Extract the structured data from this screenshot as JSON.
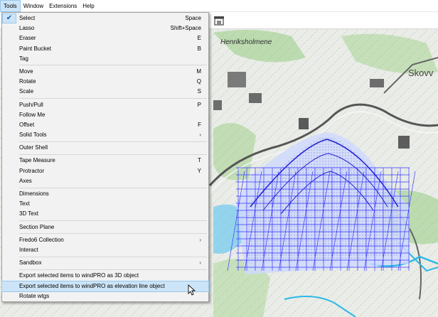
{
  "menubar": {
    "items": [
      {
        "label": "Tools",
        "active": true
      },
      {
        "label": "Window",
        "active": false
      },
      {
        "label": "Extensions",
        "active": false
      },
      {
        "label": "Help",
        "active": false
      }
    ]
  },
  "map": {
    "label_henriksholm": "Henriksholmene",
    "label_skov": "Skovv",
    "colors": {
      "background": "#e9ece7",
      "grid": "#3a3aff",
      "water": "#2bb9e8",
      "green": "#bcdcb0",
      "road": "#5a5a5a"
    }
  },
  "menu": {
    "groups": [
      [
        {
          "label": "Select",
          "shortcut": "Space",
          "checked": true
        },
        {
          "label": "Lasso",
          "shortcut": "Shift+Space"
        },
        {
          "label": "Eraser",
          "shortcut": "E"
        },
        {
          "label": "Paint Bucket",
          "shortcut": "B"
        },
        {
          "label": "Tag",
          "shortcut": ""
        }
      ],
      [
        {
          "label": "Move",
          "shortcut": "M"
        },
        {
          "label": "Rotate",
          "shortcut": "Q"
        },
        {
          "label": "Scale",
          "shortcut": "S"
        }
      ],
      [
        {
          "label": "Push/Pull",
          "shortcut": "P"
        },
        {
          "label": "Follow Me",
          "shortcut": ""
        },
        {
          "label": "Offset",
          "shortcut": "F"
        },
        {
          "label": "Solid Tools",
          "shortcut": "",
          "submenu": true
        }
      ],
      [
        {
          "label": "Outer Shell",
          "shortcut": ""
        }
      ],
      [
        {
          "label": "Tape Measure",
          "shortcut": "T"
        },
        {
          "label": "Protractor",
          "shortcut": "Y"
        },
        {
          "label": "Axes",
          "shortcut": ""
        }
      ],
      [
        {
          "label": "Dimensions",
          "shortcut": ""
        },
        {
          "label": "Text",
          "shortcut": ""
        },
        {
          "label": "3D Text",
          "shortcut": ""
        }
      ],
      [
        {
          "label": "Section Plane",
          "shortcut": ""
        }
      ],
      [
        {
          "label": "Fredo6 Collection",
          "shortcut": "",
          "submenu": true
        },
        {
          "label": "Interact",
          "shortcut": ""
        }
      ],
      [
        {
          "label": "Sandbox",
          "shortcut": "",
          "submenu": true
        }
      ],
      [
        {
          "label": "Export selected items to windPRO as 3D object",
          "shortcut": ""
        },
        {
          "label": "Export selected items to windPRO as elevation line object",
          "shortcut": "",
          "hover": true
        },
        {
          "label": "Rotate wtgs",
          "shortcut": ""
        }
      ]
    ]
  }
}
